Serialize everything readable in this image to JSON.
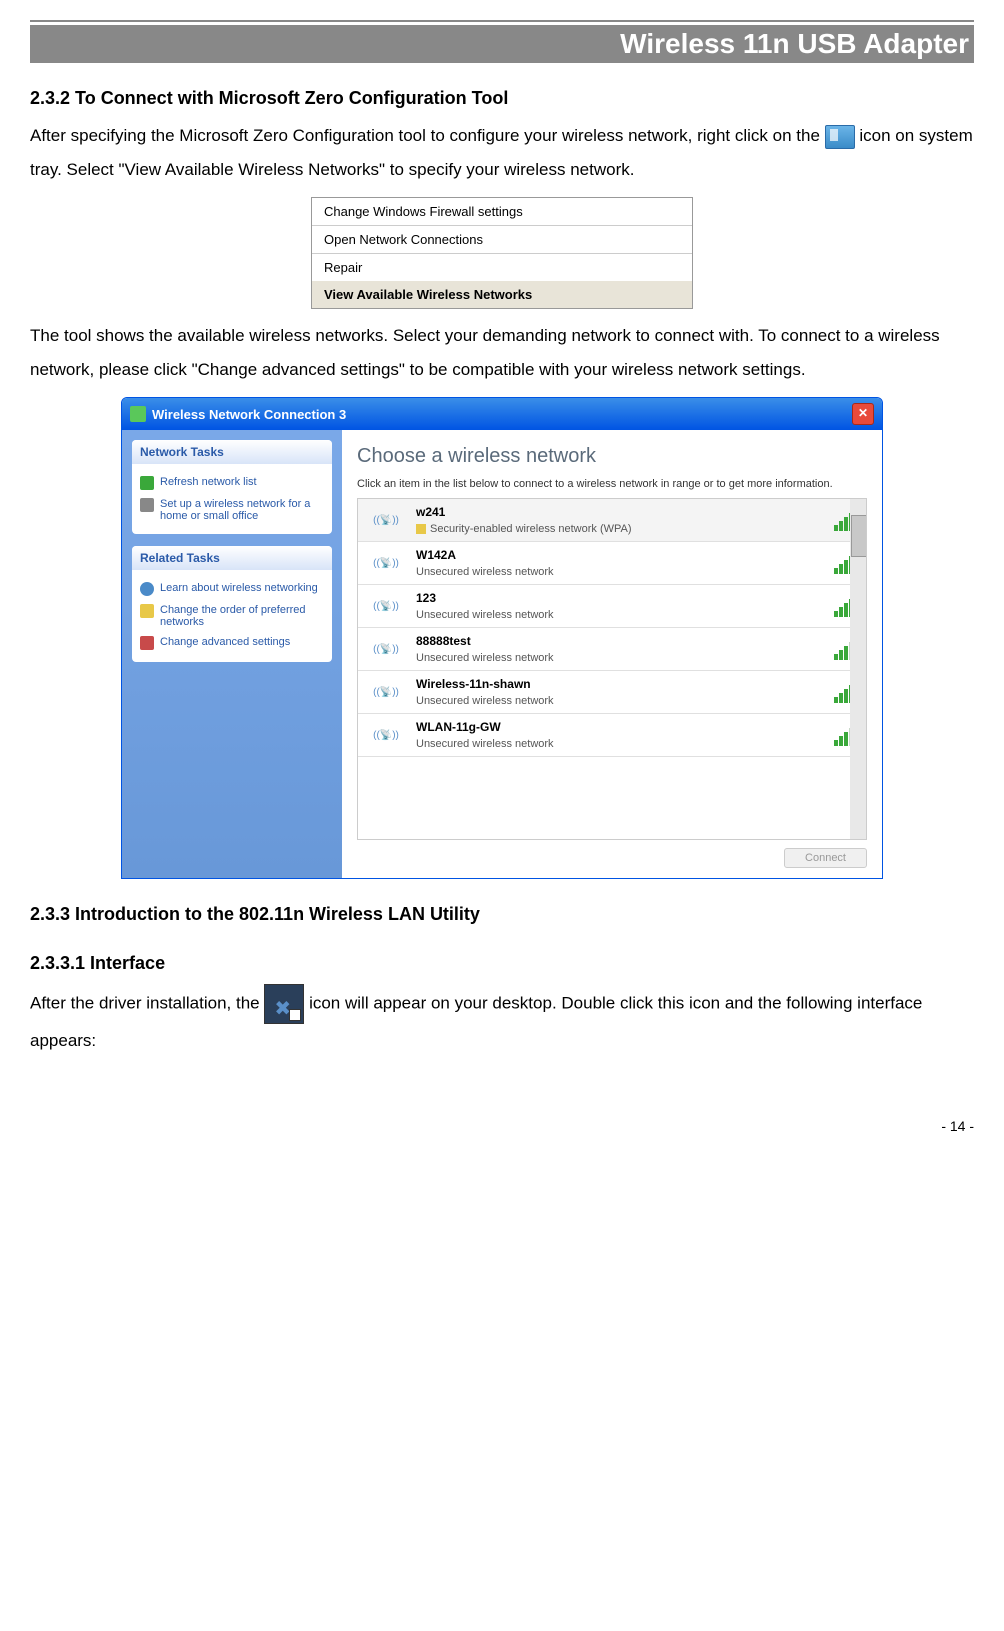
{
  "header": {
    "title": "Wireless 11n USB Adapter"
  },
  "section_232": {
    "heading": "2.3.2    To Connect with Microsoft Zero Configuration Tool",
    "para1_a": "After specifying the Microsoft Zero Configuration tool to configure your wireless network, right click on the ",
    "para1_b": " icon on system tray. Select \"View Available Wireless Networks\" to specify your wireless network.",
    "para2": "The tool shows the available wireless networks. Select your demanding network to connect with. To connect to a wireless network, please click \"Change advanced settings\" to be compatible with your wireless network settings."
  },
  "context_menu": {
    "items": [
      "Change Windows Firewall settings",
      "Open Network Connections",
      "Repair",
      "View Available Wireless Networks"
    ]
  },
  "dialog": {
    "title": "Wireless Network Connection 3",
    "sidebar": {
      "panel1_header": "Network Tasks",
      "panel1_links": [
        {
          "label": "Refresh network list",
          "icon": "refresh"
        },
        {
          "label": "Set up a wireless network for a home or small office",
          "icon": "setup"
        }
      ],
      "panel2_header": "Related Tasks",
      "panel2_links": [
        {
          "label": "Learn about wireless networking",
          "icon": "info"
        },
        {
          "label": "Change the order of preferred networks",
          "icon": "star"
        },
        {
          "label": "Change advanced settings",
          "icon": "advanced"
        }
      ]
    },
    "main": {
      "heading": "Choose a wireless network",
      "subtext": "Click an item in the list below to connect to a wireless network in range or to get more information.",
      "networks": [
        {
          "name": "w241",
          "desc": "Security-enabled wireless network (WPA)",
          "secured": true,
          "signal": 5
        },
        {
          "name": "W142A",
          "desc": "Unsecured wireless network",
          "secured": false,
          "signal": 5
        },
        {
          "name": "123",
          "desc": "Unsecured wireless network",
          "secured": false,
          "signal": 5
        },
        {
          "name": "88888test",
          "desc": "Unsecured wireless network",
          "secured": false,
          "signal": 3
        },
        {
          "name": "Wireless-11n-shawn",
          "desc": "Unsecured wireless network",
          "secured": false,
          "signal": 5
        },
        {
          "name": "WLAN-11g-GW",
          "desc": "Unsecured wireless network",
          "secured": false,
          "signal": 3
        }
      ],
      "connect_label": "Connect"
    }
  },
  "section_233": {
    "heading": "2.3.3    Introduction to the 802.11n Wireless LAN Utility"
  },
  "section_2331": {
    "heading": "2.3.3.1    Interface",
    "para_a": "After the driver installation, the ",
    "para_b": " icon will appear on your desktop. Double click this icon and the following interface appears:"
  },
  "page_number": "- 14 -"
}
